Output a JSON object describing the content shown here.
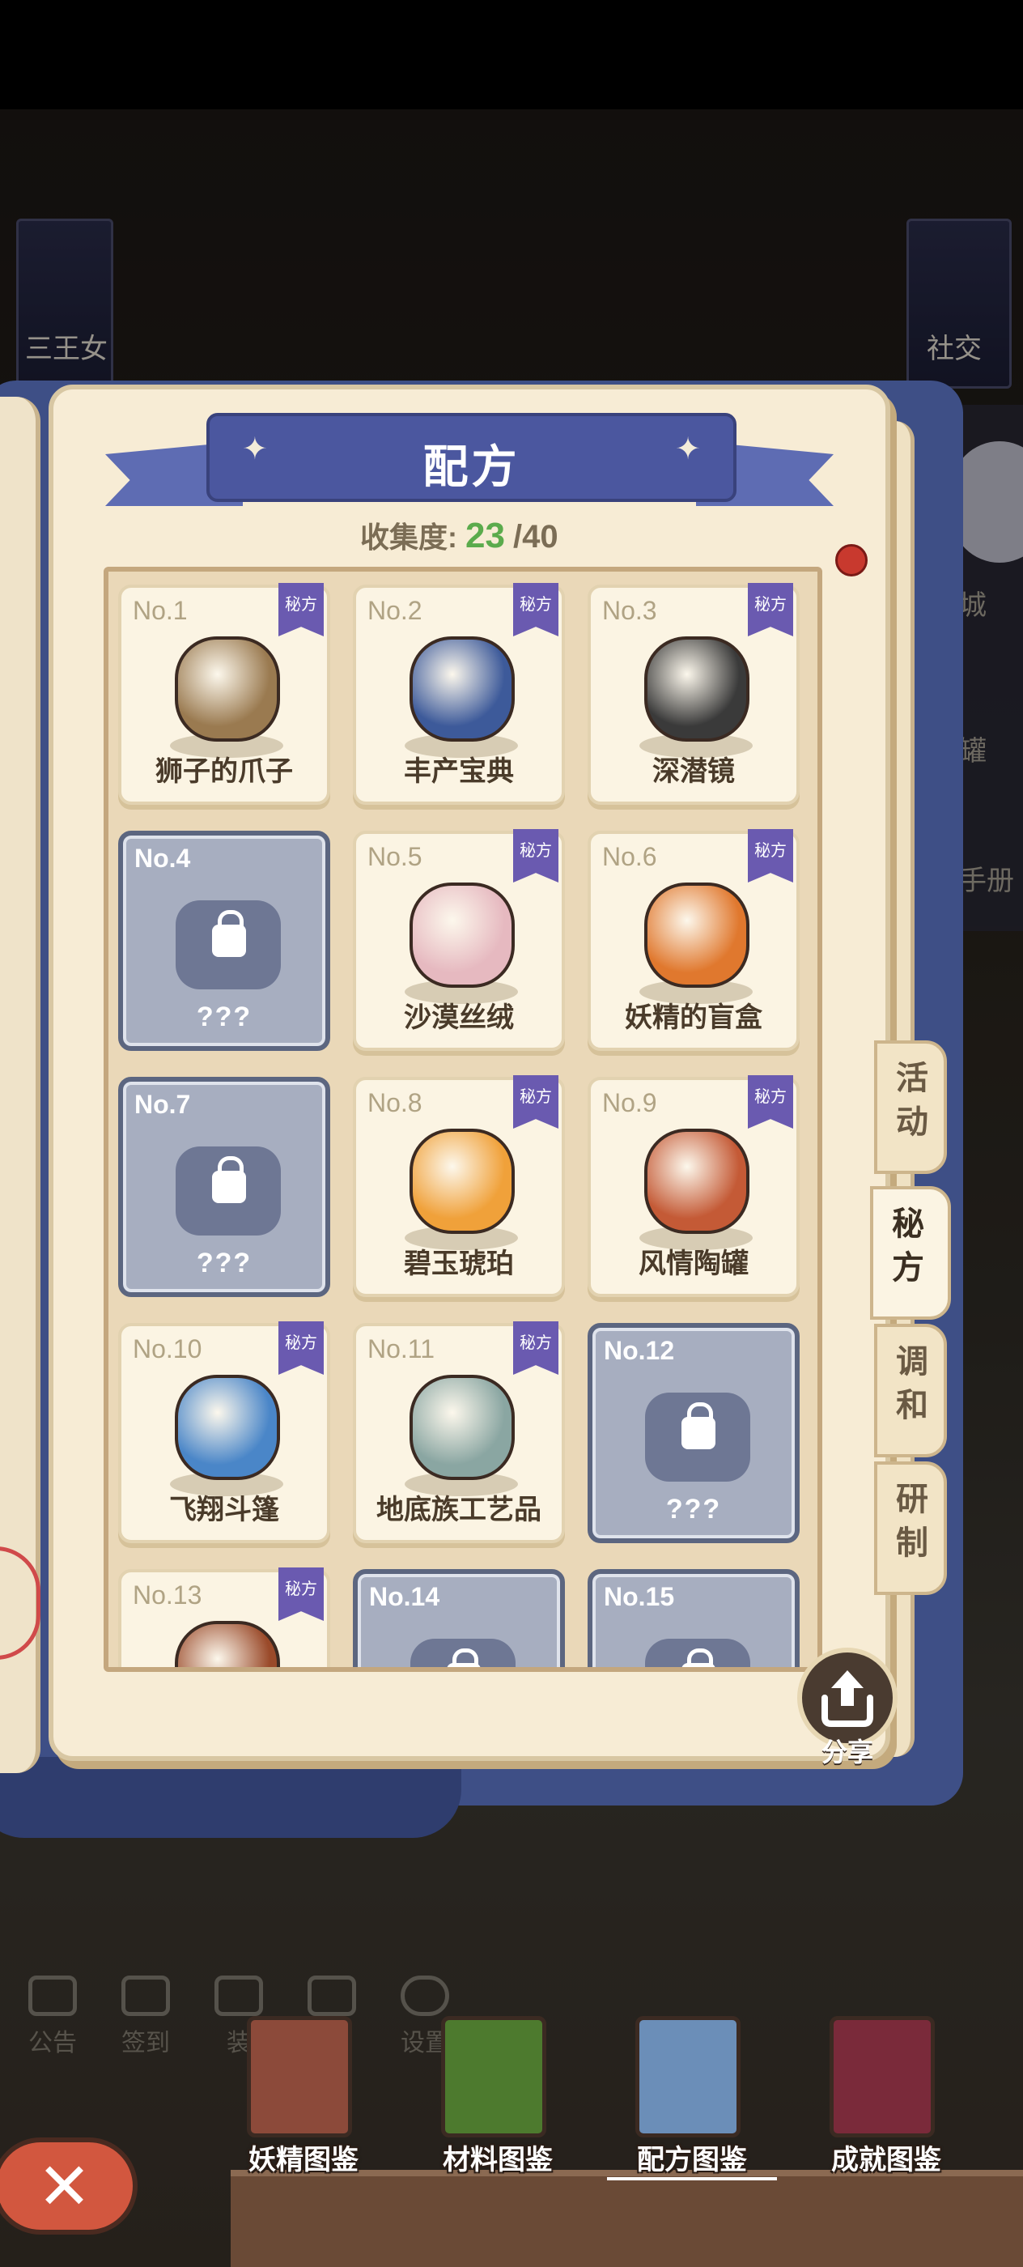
{
  "background": {
    "left_banner_label": "三王女",
    "right_banner_label": "社交",
    "right_side_labels": [
      "城",
      "罐",
      "手册"
    ]
  },
  "header": {
    "title": "配方",
    "collection_label": "收集度:",
    "collected": "23",
    "total": "/40"
  },
  "secret_tag": "秘方",
  "cards": [
    {
      "no": "No.1",
      "name": "狮子的爪子",
      "locked": false,
      "icon": "paw-icon",
      "color": "#9a7a50"
    },
    {
      "no": "No.2",
      "name": "丰产宝典",
      "locked": false,
      "icon": "book-icon",
      "color": "#3d5a9a"
    },
    {
      "no": "No.3",
      "name": "深潜镜",
      "locked": false,
      "icon": "goggles-icon",
      "color": "#3a3a3a"
    },
    {
      "no": "No.4",
      "name": "???",
      "locked": true,
      "icon": "lock-icon"
    },
    {
      "no": "No.5",
      "name": "沙漠丝绒",
      "locked": false,
      "icon": "cloth-icon",
      "color": "#e6b9c0"
    },
    {
      "no": "No.6",
      "name": "妖精的盲盒",
      "locked": false,
      "icon": "box-icon",
      "color": "#e0782e"
    },
    {
      "no": "No.7",
      "name": "???",
      "locked": true,
      "icon": "lock-icon"
    },
    {
      "no": "No.8",
      "name": "碧玉琥珀",
      "locked": false,
      "icon": "amber-ring-icon",
      "color": "#f0a13a"
    },
    {
      "no": "No.9",
      "name": "风情陶罐",
      "locked": false,
      "icon": "pottery-icon",
      "color": "#c45a36"
    },
    {
      "no": "No.10",
      "name": "飞翔斗篷",
      "locked": false,
      "icon": "cloak-icon",
      "color": "#4a86c8"
    },
    {
      "no": "No.11",
      "name": "地底族工艺品",
      "locked": false,
      "icon": "craft-icon",
      "color": "#8aa6a2"
    },
    {
      "no": "No.12",
      "name": "???",
      "locked": true,
      "icon": "lock-icon"
    },
    {
      "no": "No.13",
      "name": "",
      "locked": false,
      "icon": "item-icon",
      "color": "#9a4a2a"
    },
    {
      "no": "No.14",
      "name": "",
      "locked": true,
      "icon": "lock-icon"
    },
    {
      "no": "No.15",
      "name": "",
      "locked": true,
      "icon": "lock-icon"
    }
  ],
  "side_tabs": [
    {
      "label": "活动",
      "active": false
    },
    {
      "label": "秘方",
      "active": true
    },
    {
      "label": "调和",
      "active": false
    },
    {
      "label": "研制",
      "active": false
    }
  ],
  "share_label": "分享",
  "utility_menu": [
    {
      "label": "公告",
      "icon": "notice-icon"
    },
    {
      "label": "签到",
      "icon": "calendar-icon"
    },
    {
      "label": "装",
      "icon": "decor-icon"
    },
    {
      "label": "",
      "icon": "save-icon"
    },
    {
      "label": "设置",
      "icon": "gear-icon"
    }
  ],
  "bottom_nav": [
    {
      "label": "妖精图鉴",
      "active": false,
      "color": "#8c4a3a"
    },
    {
      "label": "材料图鉴",
      "active": false,
      "color": "#4d7a2e"
    },
    {
      "label": "配方图鉴",
      "active": true,
      "color": "#6b8eb8"
    },
    {
      "label": "成就图鉴",
      "active": false,
      "color": "#7a2a3a"
    }
  ],
  "close_label": "✕"
}
